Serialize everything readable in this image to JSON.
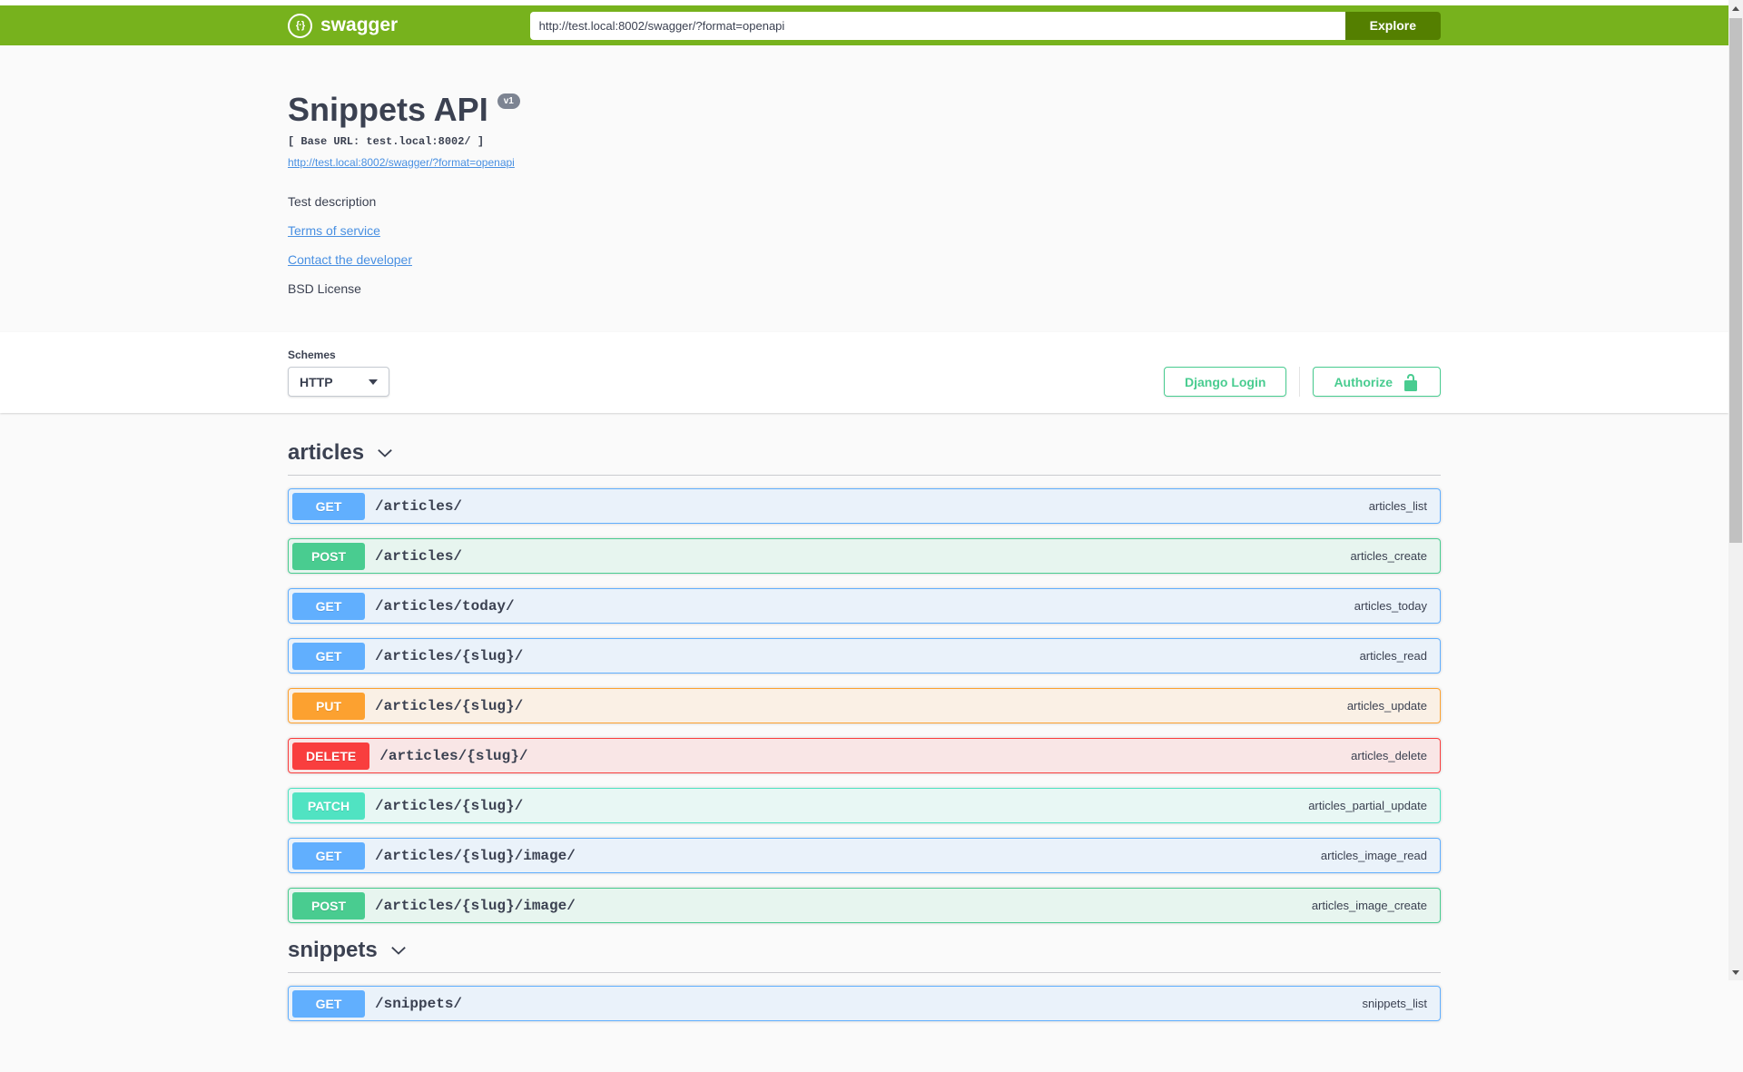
{
  "topbar": {
    "logo_text": "swagger",
    "url_value": "http://test.local:8002/swagger/?format=openapi",
    "explore_label": "Explore"
  },
  "info": {
    "title": "Snippets API",
    "version_badge": "v1",
    "base_url": "[ Base URL: test.local:8002/ ]",
    "spec_link": "http://test.local:8002/swagger/?format=openapi",
    "description": "Test description",
    "terms_label": "Terms of service",
    "contact_label": "Contact the developer",
    "license": "BSD License"
  },
  "scheme": {
    "label": "Schemes",
    "selected": "HTTP",
    "django_login_label": "Django Login",
    "authorize_label": "Authorize"
  },
  "sections": [
    {
      "tag": "articles",
      "operations": [
        {
          "method": "GET",
          "path": "/articles/",
          "op_id": "articles_list"
        },
        {
          "method": "POST",
          "path": "/articles/",
          "op_id": "articles_create"
        },
        {
          "method": "GET",
          "path": "/articles/today/",
          "op_id": "articles_today"
        },
        {
          "method": "GET",
          "path": "/articles/{slug}/",
          "op_id": "articles_read"
        },
        {
          "method": "PUT",
          "path": "/articles/{slug}/",
          "op_id": "articles_update"
        },
        {
          "method": "DELETE",
          "path": "/articles/{slug}/",
          "op_id": "articles_delete"
        },
        {
          "method": "PATCH",
          "path": "/articles/{slug}/",
          "op_id": "articles_partial_update"
        },
        {
          "method": "GET",
          "path": "/articles/{slug}/image/",
          "op_id": "articles_image_read"
        },
        {
          "method": "POST",
          "path": "/articles/{slug}/image/",
          "op_id": "articles_image_create"
        }
      ]
    },
    {
      "tag": "snippets",
      "operations": [
        {
          "method": "GET",
          "path": "/snippets/",
          "op_id": "snippets_list"
        }
      ]
    }
  ],
  "colors": {
    "topbar": "#77b21d",
    "explore_button": "#547f00",
    "link": "#4990e2",
    "auth_button": "#49cc90",
    "get": "#61affe",
    "post": "#49cc90",
    "put": "#fca130",
    "delete": "#f93e3e",
    "patch": "#50e3c2",
    "text": "#3b4151",
    "page_background": "#fafafa"
  }
}
